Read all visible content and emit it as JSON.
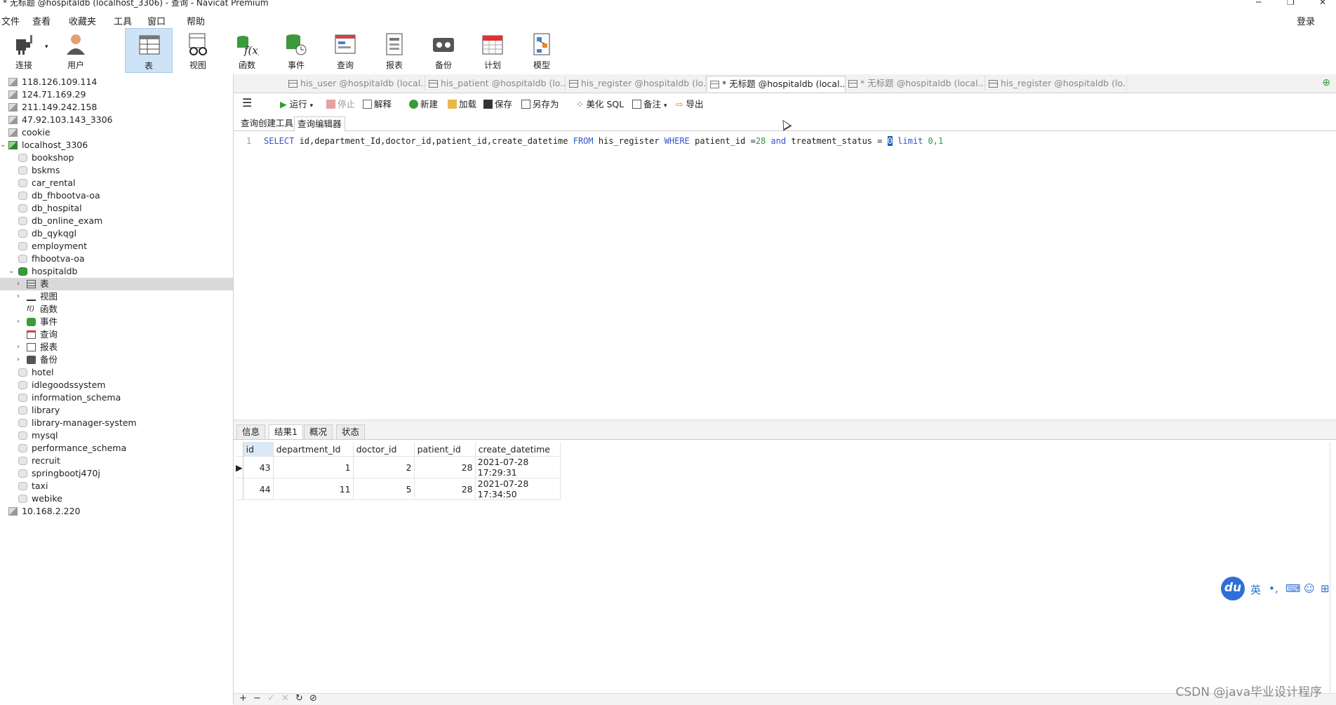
{
  "window": {
    "title": "* 无标题 @hospitaldb (localhost_3306) - 查询 - Navicat Premium",
    "login": "登录"
  },
  "menu": [
    "文件",
    "查看",
    "收藏夹",
    "工具",
    "窗口",
    "帮助"
  ],
  "toolbar": [
    {
      "label": "连接",
      "icon": "plug-icon"
    },
    {
      "label": "用户",
      "icon": "user-icon"
    },
    {
      "label": "表",
      "icon": "table-icon"
    },
    {
      "label": "视图",
      "icon": "view-icon"
    },
    {
      "label": "函数",
      "icon": "function-icon"
    },
    {
      "label": "事件",
      "icon": "event-icon"
    },
    {
      "label": "查询",
      "icon": "query-icon"
    },
    {
      "label": "报表",
      "icon": "report-icon"
    },
    {
      "label": "备份",
      "icon": "backup-icon"
    },
    {
      "label": "计划",
      "icon": "schedule-icon"
    },
    {
      "label": "模型",
      "icon": "model-icon"
    }
  ],
  "tree": [
    "118.126.109.114",
    "124.71.169.29",
    "211.149.242.158",
    "47.92.103.143_3306",
    "cookie",
    "localhost_3306",
    "bookshop",
    "bskms",
    "car_rental",
    "db_fhbootva-oa",
    "db_hospital",
    "db_online_exam",
    "db_qykqgl",
    "employment",
    "fhbootva-oa",
    "hospitaldb",
    "表",
    "视图",
    "函数",
    "事件",
    "查询",
    "报表",
    "备份",
    "hotel",
    "idlegoodssystem",
    "information_schema",
    "library",
    "library-manager-system",
    "mysql",
    "performance_schema",
    "recruit",
    "springbootj470j",
    "taxi",
    "webike",
    "10.168.2.220"
  ],
  "tabs": [
    "his_user @hospitaldb (local...",
    "his_patient @hospitaldb (lo...",
    "his_register @hospitaldb (lo...",
    "* 无标题 @hospitaldb (local...",
    "* 无标题 @hospitaldb (local...",
    "his_register @hospitaldb (lo..."
  ],
  "query_toolbar": {
    "run": "运行",
    "stop": "停止",
    "explain": "解释",
    "new": "新建",
    "load": "加载",
    "save": "保存",
    "save_as": "另存为",
    "beautify": "美化 SQL",
    "note": "备注",
    "export": "导出"
  },
  "editor_tabs": [
    "查询创建工具",
    "查询编辑器"
  ],
  "sql": {
    "line_no": "1",
    "p1": "SELECT",
    "p2": " id,department_Id,doctor_id,patient_id,create_datetime ",
    "p3": "FROM",
    "p4": " his_register ",
    "p5": "WHERE",
    "p6": " patient_id =",
    "p7": "28",
    "p8": " ",
    "p9": "and",
    "p10": " treatment_status = ",
    "p11": "0",
    "p12": " ",
    "p13": "limit",
    "p14": " ",
    "p15": "0,1"
  },
  "result_tabs": [
    "信息",
    "结果1",
    "概况",
    "状态"
  ],
  "result": {
    "columns": [
      "id",
      "department_Id",
      "doctor_id",
      "patient_id",
      "create_datetime"
    ],
    "rows": [
      [
        "43",
        "1",
        "2",
        "28",
        "2021-07-28 17:29:31"
      ],
      [
        "44",
        "11",
        "5",
        "28",
        "2021-07-28 17:34:50"
      ]
    ]
  },
  "ime": {
    "logo": "du",
    "lang": "英"
  },
  "watermark": "CSDN @java毕业设计程序"
}
